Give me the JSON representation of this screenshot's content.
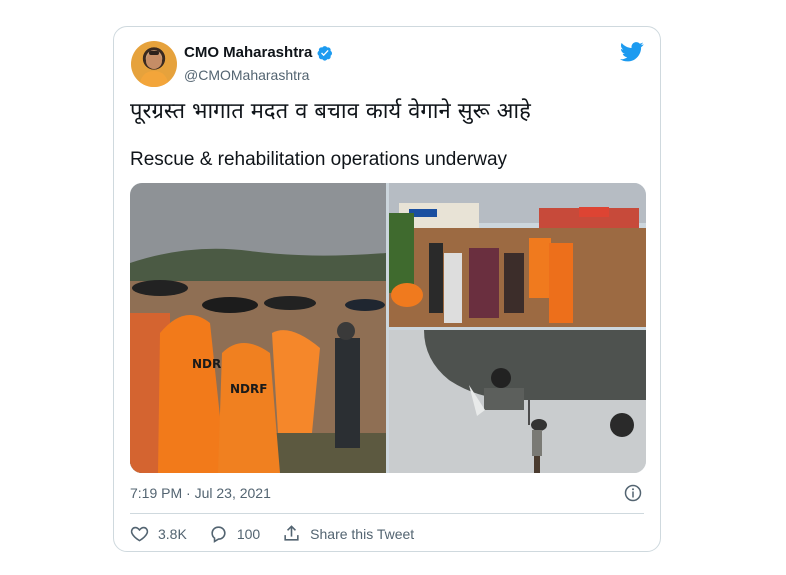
{
  "tweet": {
    "display_name": "CMO Maharashtra",
    "handle": "@CMOMaharashtra",
    "text_marathi": "पूरग्रस्त भागात मदत व बचाव कार्य वेगाने सुरू आहे",
    "text_english": "Rescue & rehabilitation operations underway",
    "timestamp": "7:19 PM · Jul 23, 2021",
    "verified": true
  },
  "media": {
    "photos": [
      {
        "name": "rescue-team-floodwater-photo",
        "badge": "NDRF"
      },
      {
        "name": "flooded-street-rescue-photo",
        "badge": ""
      },
      {
        "name": "helicopter-winch-rescue-photo",
        "badge": ""
      }
    ]
  },
  "actions": {
    "likes": "3.8K",
    "replies": "100",
    "share_label": "Share this Tweet"
  },
  "colors": {
    "twitter_blue": "#1d9bf0",
    "text_primary": "#0f1419",
    "text_secondary": "#536471",
    "border": "#cfd9de",
    "ndrf_orange": "#f27a1a"
  },
  "icons": [
    "verified-badge-icon",
    "twitter-bird-icon",
    "info-icon",
    "heart-icon",
    "reply-icon",
    "share-icon"
  ]
}
